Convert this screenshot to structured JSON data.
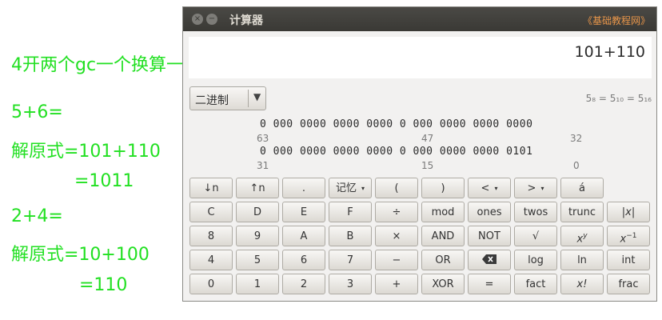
{
  "notes": {
    "line1": "4开两个gc一个换算一",
    "line2": "5+6=",
    "line3": "解原式=101+110",
    "line4": "=1011",
    "line5": "2+4=",
    "line6": "解原式=10+100",
    "line7": "=110"
  },
  "window": {
    "title": "计算器",
    "site_link": "《基础教程网》",
    "close_glyph": "×",
    "minimize_glyph": "−"
  },
  "display": {
    "value": "101+110"
  },
  "mode_select": {
    "selected": "二进制",
    "arrow": "▼"
  },
  "base_info": "5₈ = 5₁₀ = 5₁₆",
  "bit_panel": {
    "row1_bits": "0 000  0000  0000  0000    0 000  0000  0000  0000",
    "row1_idx": [
      "63",
      "47",
      "32"
    ],
    "row2_bits": "0 000  0000  0000  0000    0 000  0000  0000  0101",
    "row2_idx": [
      "31",
      "15",
      "0"
    ]
  },
  "keys": {
    "row1": [
      "↓n",
      "↑n",
      ".",
      "记忆",
      "(",
      ")",
      "<",
      ">",
      "á"
    ],
    "row2": [
      "C",
      "D",
      "E",
      "F",
      "÷",
      "mod",
      "ones",
      "twos",
      "trunc",
      "|x|"
    ],
    "row3": [
      "8",
      "9",
      "A",
      "B",
      "×",
      "AND",
      "NOT",
      "√",
      "x",
      "x"
    ],
    "row3_sup": [
      "y",
      "−1"
    ],
    "row4": [
      "4",
      "5",
      "6",
      "7",
      "−",
      "OR",
      "",
      "log",
      "ln",
      "int"
    ],
    "row5": [
      "0",
      "1",
      "2",
      "3",
      "+",
      "XOR",
      "=",
      "fact",
      "x!",
      "frac"
    ],
    "dropdown_glyph": "▾"
  }
}
